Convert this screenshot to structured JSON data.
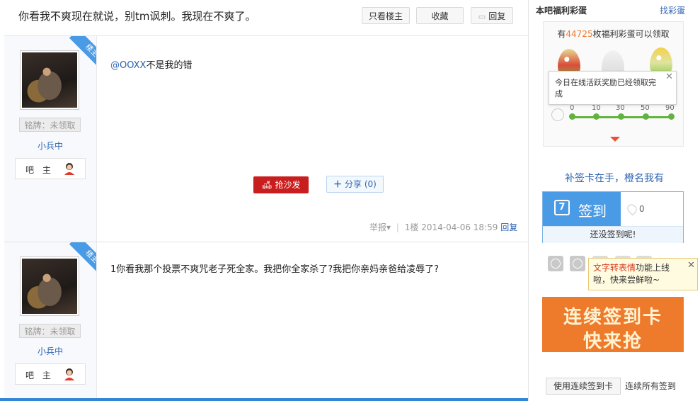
{
  "thread": {
    "title": "你看我不爽现在就说，别tm讽刺。我现在不爽了。",
    "btn_only_op": "只看楼主",
    "btn_collect": "收藏",
    "btn_reply": "回复"
  },
  "posts": [
    {
      "ribbon": "楼主",
      "badge": "铭牌：未领取",
      "username": "小兵中",
      "role": "吧 主",
      "content_mention": "@OOXX",
      "content_text": "不是我的错",
      "sofa_label": "抢沙发",
      "share_label": "分享",
      "share_count": "(0)",
      "report": "举报",
      "floor": "1楼",
      "time": "2014-04-06 18:59",
      "reply": "回复"
    },
    {
      "ribbon": "楼主",
      "badge": "铭牌：未领取",
      "username": "小兵中",
      "role": "吧 主",
      "content_text": "1你看我那个投票不爽咒老子死全家。我把你全家杀了?我把你亲妈亲爸给凌辱了?"
    }
  ],
  "sidebar": {
    "head_title": "本吧福利彩蛋",
    "head_link": "找彩蛋",
    "egg_prefix": "有",
    "egg_count": "44725",
    "egg_suffix": "枚福利彩蛋可以领取",
    "tooltip": "今日在线活跃奖励已经领取完成",
    "milestones": [
      "0",
      "10",
      "30",
      "50",
      "90"
    ],
    "slogan": "补签卡在手，橙名我有",
    "sign_label": "签到",
    "sign_cal": "7",
    "sign_count": "0",
    "sign_note": "还没签到呢!",
    "tip_highlight": "文字转表情",
    "tip_rest": "功能上线啦，快来尝鲜啦~",
    "banner_line1": "连续签到卡",
    "banner_line2": "快来抢",
    "use_card": "使用连续签到卡",
    "all_sign": "连续所有签到"
  },
  "colors": {
    "accent": "#4a9be6",
    "link": "#2d64b3",
    "sofa": "#c81e1e",
    "banner": "#ee7a2c",
    "progress": "#61b33d"
  }
}
